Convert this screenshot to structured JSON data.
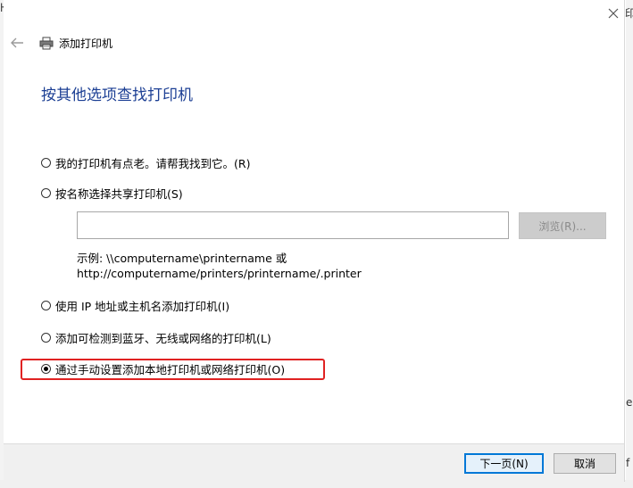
{
  "window": {
    "title": "添加打印机"
  },
  "page": {
    "heading": "按其他选项查找打印机"
  },
  "options": [
    {
      "label": "我的打印机有点老。请帮我找到它。(R)",
      "selected": false
    },
    {
      "label": "按名称选择共享打印机(S)",
      "selected": false
    },
    {
      "label": "使用 IP 地址或主机名添加打印机(I)",
      "selected": false
    },
    {
      "label": "添加可检测到蓝牙、无线或网络的打印机(L)",
      "selected": false
    },
    {
      "label": "通过手动设置添加本地打印机或网络打印机(O)",
      "selected": true
    }
  ],
  "share": {
    "input_value": "",
    "browse_label": "浏览(R)...",
    "example_line1": "示例: \\\\computername\\printername 或",
    "example_line2": "http://computername/printers/printername/.printer"
  },
  "footer": {
    "next_label": "下一页(N)",
    "cancel_label": "取消"
  },
  "background": {
    "glyph_top_left": "ŀ",
    "glyph_top_right": "印",
    "glyph_mid_right": "e",
    "glyph_bottom_right": "f"
  },
  "colors": {
    "heading": "#1c3f94",
    "highlight": "#e02222",
    "default_button_border": "#0078d7"
  }
}
